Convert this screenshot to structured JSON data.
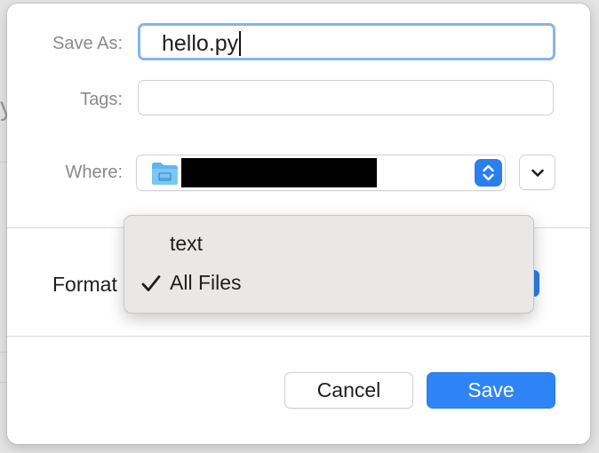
{
  "dialog": {
    "save_as_label": "Save As:",
    "filename_value": "hello.py",
    "tags_label": "Tags:",
    "tags_value": "",
    "where_label": "Where:",
    "format_label": "Format"
  },
  "format_menu": {
    "items": [
      {
        "label": "text",
        "checked": false
      },
      {
        "label": "All Files",
        "checked": true
      }
    ]
  },
  "buttons": {
    "cancel": "Cancel",
    "save": "Save"
  },
  "icons": {
    "folder": "folder-icon",
    "stepper": "up-down-chevron-icon",
    "expand": "chevron-down-icon",
    "check": "checkmark-icon"
  },
  "colors": {
    "accent": "#2f84f5",
    "focus_ring": "#8ab2ee",
    "folder": "#5fb6ec"
  }
}
